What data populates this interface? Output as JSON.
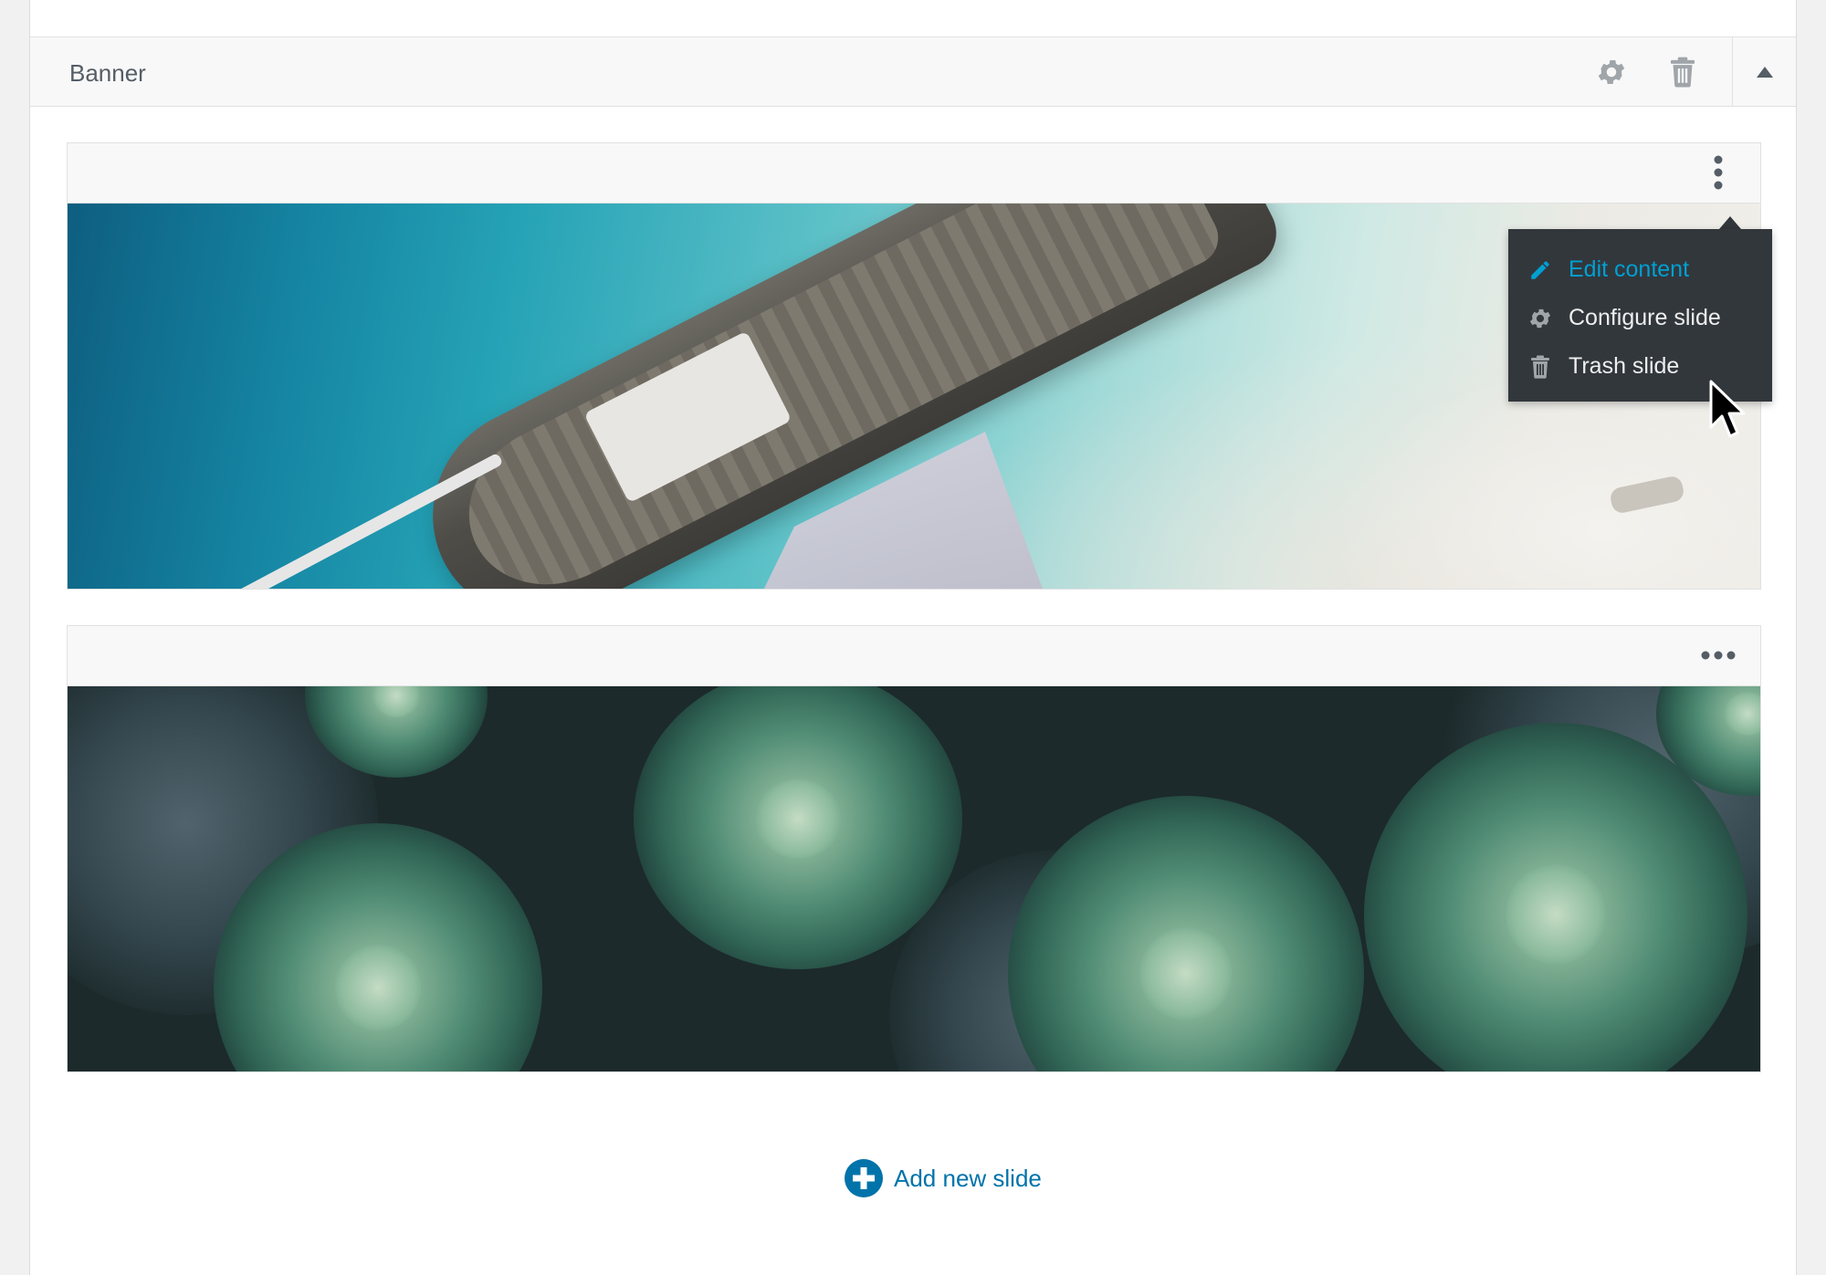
{
  "panel": {
    "title": "Banner",
    "icons": [
      "gear-icon",
      "trash-icon",
      "caret-up-icon"
    ]
  },
  "slides": [
    {
      "menu_icon": "vertical-ellipsis-icon",
      "image_subject": "boat-on-beach",
      "menu_open": true
    },
    {
      "menu_icon": "horizontal-ellipsis-icon",
      "image_subject": "succulents",
      "menu_open": false
    }
  ],
  "slide_menu": {
    "items": [
      {
        "label": "Edit content",
        "icon": "pencil-icon",
        "state": "hover"
      },
      {
        "label": "Configure slide",
        "icon": "gear-icon"
      },
      {
        "label": "Trash slide",
        "icon": "trash-icon"
      }
    ]
  },
  "add_slide": {
    "label": "Add new slide",
    "icon": "plus-circle-icon"
  },
  "colors": {
    "accent": "#0073aa",
    "menu_active": "#00a0d2",
    "menu_bg": "#32373c",
    "icon_gray": "#a0a5aa"
  }
}
